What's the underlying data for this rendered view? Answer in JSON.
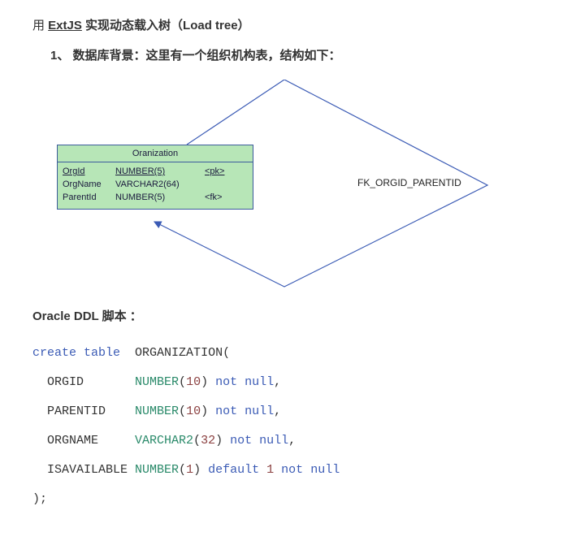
{
  "heading": {
    "prefix": "用 ",
    "extjs": "ExtJS",
    "suffix": "  实现动态载入树（Load tree）"
  },
  "listItem": {
    "number": "1、",
    "text": "数据库背景：这里有一个组织机构表，结构如下："
  },
  "entity": {
    "title": "Oranization",
    "rows": [
      {
        "name": "OrgId",
        "type": "NUMBER(5)",
        "key": "<pk>",
        "underlineName": true,
        "underlineType": true,
        "underlineKey": true
      },
      {
        "name": "OrgName",
        "type": "VARCHAR2(64)",
        "key": "",
        "underlineName": false,
        "underlineType": false,
        "underlineKey": false
      },
      {
        "name": "ParentId",
        "type": "NUMBER(5)",
        "key": "<fk>",
        "underlineName": false,
        "underlineType": false,
        "underlineKey": false
      }
    ]
  },
  "fkLabel": "FK_ORGID_PARENTID",
  "ddl": {
    "title": "Oracle DDL 脚本 ：",
    "lines": [
      [
        {
          "t": "create",
          "c": "kw-blue"
        },
        {
          "t": " ",
          "c": ""
        },
        {
          "t": "table",
          "c": "kw-blue"
        },
        {
          "t": "  ORGANIZATION(",
          "c": ""
        }
      ],
      [
        {
          "t": "  ORGID       ",
          "c": ""
        },
        {
          "t": "NUMBER",
          "c": "kw-teal"
        },
        {
          "t": "(",
          "c": ""
        },
        {
          "t": "10",
          "c": "kw-red"
        },
        {
          "t": ") ",
          "c": ""
        },
        {
          "t": "not",
          "c": "kw-blue"
        },
        {
          "t": " ",
          "c": ""
        },
        {
          "t": "null",
          "c": "kw-blue"
        },
        {
          "t": ",",
          "c": ""
        }
      ],
      [
        {
          "t": "  PARENTID    ",
          "c": ""
        },
        {
          "t": "NUMBER",
          "c": "kw-teal"
        },
        {
          "t": "(",
          "c": ""
        },
        {
          "t": "10",
          "c": "kw-red"
        },
        {
          "t": ") ",
          "c": ""
        },
        {
          "t": "not",
          "c": "kw-blue"
        },
        {
          "t": " ",
          "c": ""
        },
        {
          "t": "null",
          "c": "kw-blue"
        },
        {
          "t": ",",
          "c": ""
        }
      ],
      [
        {
          "t": "  ORGNAME     ",
          "c": ""
        },
        {
          "t": "VARCHAR2",
          "c": "kw-teal"
        },
        {
          "t": "(",
          "c": ""
        },
        {
          "t": "32",
          "c": "kw-red"
        },
        {
          "t": ") ",
          "c": ""
        },
        {
          "t": "not",
          "c": "kw-blue"
        },
        {
          "t": " ",
          "c": ""
        },
        {
          "t": "null",
          "c": "kw-blue"
        },
        {
          "t": ",",
          "c": ""
        }
      ],
      [
        {
          "t": "  ISAVAILABLE ",
          "c": ""
        },
        {
          "t": "NUMBER",
          "c": "kw-teal"
        },
        {
          "t": "(",
          "c": ""
        },
        {
          "t": "1",
          "c": "kw-red"
        },
        {
          "t": ") ",
          "c": ""
        },
        {
          "t": "default",
          "c": "kw-blue"
        },
        {
          "t": " ",
          "c": ""
        },
        {
          "t": "1",
          "c": "kw-red"
        },
        {
          "t": " ",
          "c": ""
        },
        {
          "t": "not",
          "c": "kw-blue"
        },
        {
          "t": " ",
          "c": ""
        },
        {
          "t": "null",
          "c": "kw-blue"
        }
      ],
      [
        {
          "t": ");",
          "c": ""
        }
      ]
    ]
  }
}
